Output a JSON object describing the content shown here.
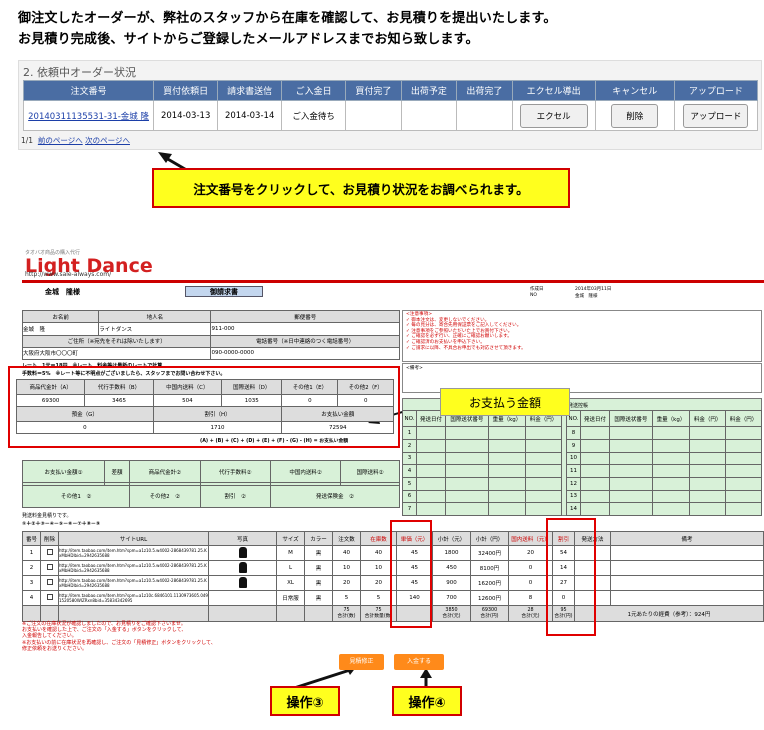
{
  "intro": {
    "line1": "御注文したオーダーが、弊社のスタッフから在庫を確認して、お見積りを提出いたします。",
    "line2": "お見積り完成後、サイトからご登録したメールアドレスまでお知ら致します。"
  },
  "order_panel": {
    "title": "2. 依頼中オーダー状況",
    "headers": [
      "注文番号",
      "買付依頼日",
      "請求書送信",
      "ご入金日",
      "買付完了",
      "出荷予定",
      "出荷完了",
      "エクセル導出",
      "キャンセル",
      "アップロード"
    ],
    "row": {
      "order_no": "20140311135531-31-金城 隆",
      "request_date": "2014-03-13",
      "invoice_date": "2014-03-14",
      "payment": "ご入金待ち",
      "excel_btn": "エクセル",
      "cancel_btn": "削除",
      "upload_btn": "アップロード"
    },
    "pager": {
      "count": "1/1",
      "prev": "前のページへ",
      "next": "次のページへ"
    }
  },
  "callouts": {
    "main": "注文番号をクリックして、お見積り状況をお調べられます。",
    "payment": "お支払う金額",
    "op3": "操作③",
    "op4": "操作④"
  },
  "invoice": {
    "brand_small": "タオバオ商品の購入代行",
    "brand": "Light Dance",
    "url": "http://www.sale-always.com/",
    "customer": "金城　隆様",
    "doc_title": "御請求書",
    "date_label": "作成日",
    "date_value": "2014年03月11日",
    "no_label": "NO",
    "no_value": "金城　隆様",
    "addr_headers": [
      "お名前",
      "地人名",
      "郵便番号"
    ],
    "addr_values": [
      "金城　隆",
      "ライトダンス",
      "911-000"
    ],
    "addr_headers2": [
      "ご住所（※宛先をそれは除いたします）",
      "電話番号（※日中連絡のつく電話番号）"
    ],
    "addr_values2": [
      "大阪府大阪市〇〇〇町",
      "090-0000-0000"
    ],
    "notes_title": "<注意事項>",
    "notes": [
      "✓ 御本注文は、変更しないでください。",
      "✓ 毎の見分は、寄合先用保証票をご記入してください。",
      "✓ 注意事項をご参照いただいた上でお買付下さい。",
      "✓ ご確認を必ず行い、正確にご確認お願いします。",
      "✓ ご確認済のお支払いを申込下さい。",
      "✓ ご請求に以降、不具合お申出でも対応させて頂きます。"
    ],
    "remarks_label": "<備考>",
    "rate_line1": "レート　1元＝18円　※レート、料金等は最新のレートで計算",
    "rate_line2": "手数料＝5%　※レート等に不明点がございましたら、スタッフまでお問い合わせ下さい。",
    "fee_headers": [
      "商品代金計（A）",
      "代行手数料（B）",
      "中国内送料（C）",
      "国際送料（D）",
      "その他1（E）",
      "その他2（F）"
    ],
    "fee_values": [
      "69300",
      "3465",
      "504",
      "1035",
      "0",
      "0"
    ],
    "fee_headers2": [
      "預金（G）",
      "割引（H）",
      "お支払い金額"
    ],
    "fee_values2": [
      "0",
      "1710",
      "72594"
    ],
    "formula": "(A) + (B) + (C) + (D) + (E) + (F) - (G) - (H) = お支払い金額",
    "ship_title": "発送控帳",
    "ship_headers": [
      "NO.",
      "発送日付",
      "国際送状番号",
      "重量（kg）",
      "料金（円）",
      "料金（円）"
    ],
    "ship_rows": [
      "1",
      "2",
      "3",
      "4",
      "5",
      "6",
      "7"
    ],
    "ship_rows2": [
      "8",
      "9",
      "10",
      "11",
      "12",
      "13",
      "14"
    ],
    "green_headers": [
      "お支払い金額①",
      "差額",
      "商品代金計②",
      "代行手数料②",
      "中国内送料②",
      "国際送料②"
    ],
    "green_row2": [
      "その他1　②",
      "その他2　②",
      "割引　②",
      "発送保険金　②"
    ],
    "formula2": "①＋②＋③－④－⑤－⑥－⑦＋⑧－⑨",
    "formula_note": "発送料金見積りです。",
    "item_headers": [
      "番号",
      "削除",
      "サイトURL",
      "写真",
      "サイズ",
      "カラー",
      "注文数",
      "在庫数",
      "単価（元）",
      "小計（元）",
      "小計（円）",
      "国内送料（元）",
      "割引",
      "発送方法",
      "備考"
    ],
    "items": [
      {
        "no": "1",
        "url": "http://item.taobao.com/item.htm?spm=a1z10.5.w4002-2868439781.25.KxMbHDlbid=2942635688",
        "size": "M",
        "color": "黒",
        "qty": "40",
        "stock": "40",
        "price": "45",
        "sub_cny": "1800",
        "sub_jpy": "32400円",
        "ship": "20",
        "discount": "54"
      },
      {
        "no": "2",
        "url": "http://item.taobao.com/item.htm?spm=a1z10.5.w4002-2868439781.25.KxMbHDlbid=2942635688",
        "size": "L",
        "color": "黒",
        "qty": "10",
        "stock": "10",
        "price": "45",
        "sub_cny": "450",
        "sub_jpy": "8100円",
        "ship": "0",
        "discount": "14"
      },
      {
        "no": "3",
        "url": "http://item.taobao.com/item.htm?spm=a1z10.5.w4002-2868439781.25.KxMbHDlbid=2942635688",
        "size": "XL",
        "color": "黒",
        "qty": "20",
        "stock": "20",
        "price": "45",
        "sub_cny": "900",
        "sub_jpy": "16200円",
        "ship": "0",
        "discount": "27"
      },
      {
        "no": "4",
        "url": "http://item.taobao.com/item.htm?spm=a1z10c.6846101.1130973605.0491520580WIZRxn8bid=35834342695",
        "size": "日常服",
        "color": "黒",
        "qty": "5",
        "stock": "5",
        "price": "140",
        "sub_cny": "700",
        "sub_jpy": "12600円",
        "ship": "8",
        "discount": "0"
      }
    ],
    "totals": {
      "qty": "75",
      "stock": "75",
      "sub_cny": "3850",
      "sub_jpy": "69300",
      "ship": "28",
      "discount": "95",
      "note": "1元あたりの経費（参考）：924円"
    },
    "totals_labels": {
      "qty": "合計(数)",
      "stock": "合計数量(数)",
      "sub_cny": "合計(元)",
      "sub_jpy": "合計(円)",
      "ship": "合計(元)",
      "discount": "合計(円)"
    },
    "red_notes": [
      "※ご注文の在庫状況が確認しましたので、お見積りをご確認下さいませ。",
      "お支払いを確認した上で、ご注文の「入金する」ボタンをクリックして、",
      "入金報告してください。",
      "※お支払いの前に在庫状況を再確認し、ご注文の「見積修正」ボタンをクリックして、",
      "修正依頼をお送りください。"
    ],
    "btn_quote": "見積修正",
    "btn_pay": "入金する"
  }
}
